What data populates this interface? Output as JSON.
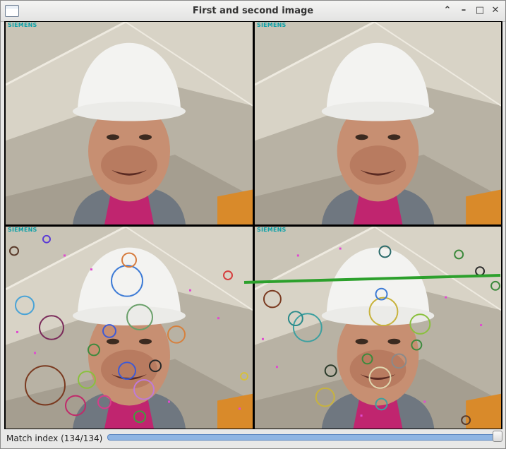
{
  "window": {
    "title": "First and second image"
  },
  "panels": {
    "top_left": {
      "brand": "SIEMENS"
    },
    "top_right": {
      "brand": "SIEMENS"
    },
    "bottom_left": {
      "brand": "SIEMENS"
    },
    "bottom_right": {
      "brand": "SIEMENS"
    }
  },
  "status": {
    "match_label": "Match index (134/134)",
    "match_index": 134,
    "match_total": 134
  },
  "colors": {
    "match_line": "#2ca02c",
    "siemens_brand": "#0aa0a8",
    "slider_fill": "#8fb5e3"
  },
  "icons": {
    "app": "app-window-icon",
    "collapse": "chevron-up-icon",
    "minimize": "minimize-icon",
    "maximize": "maximize-icon",
    "close": "close-icon"
  }
}
